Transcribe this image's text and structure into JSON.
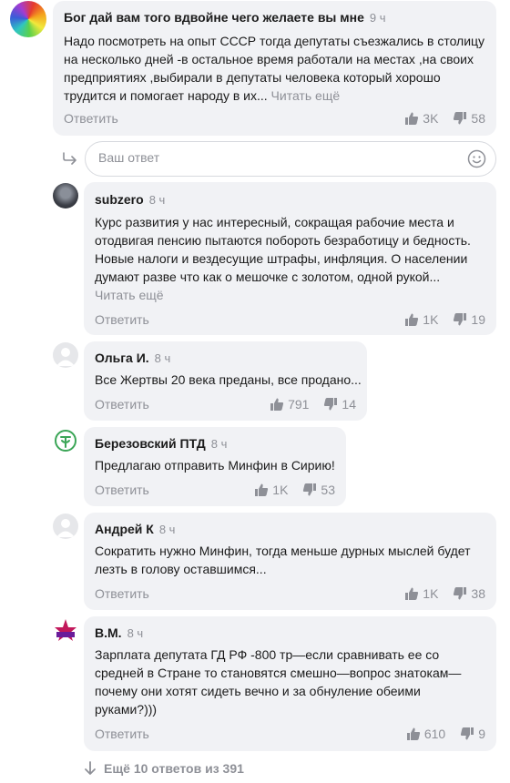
{
  "top_comment": {
    "author": "Бог дай вам того вдвойне чего желаете вы мне",
    "time": "9 ч",
    "text": "Надо посмотреть на опыт СССР тогда депутаты  съезжались в столицу на несколько дней -в остальное время работали на местах ,на своих предприятиях ,выбирали в депутаты человека который хорошо трудится и помогает народу в их...",
    "read_more": "Читать ещё",
    "reply_label": "Ответить",
    "likes": "3K",
    "dislikes": "58"
  },
  "reply_input": {
    "placeholder": "Ваш ответ"
  },
  "replies": [
    {
      "author": "subzero",
      "time": "8 ч",
      "text": "Курс развития у нас интересный, сокращая рабочие места и отодвигая пенсию пытаются побороть безработицу и бедность. Новые налоги и вездесущие штрафы, инфляция. О населении думают разве что как о мешочке с золотом, одной рукой...",
      "read_more": "Читать ещё",
      "reply_label": "Ответить",
      "likes": "1K",
      "dislikes": "19"
    },
    {
      "author": "Ольга И.",
      "time": "8 ч",
      "text": "Все Жертвы 20 века преданы, все продано...",
      "reply_label": "Ответить",
      "likes": "791",
      "dislikes": "14"
    },
    {
      "author": "Березовский ПТД",
      "time": "8 ч",
      "text": "Предлагаю отправить Минфин в Сирию!",
      "reply_label": "Ответить",
      "likes": "1K",
      "dislikes": "53"
    },
    {
      "author": "Андрей К",
      "time": "8 ч",
      "text": "Сократить нужно Минфин, тогда меньше дурных мыслей будет лезть в голову оставшимся...",
      "reply_label": "Ответить",
      "likes": "1K",
      "dislikes": "38"
    },
    {
      "author": "В.М.",
      "time": "8 ч",
      "text": "Зарплата депутата ГД РФ -800 тр—если сравнивать ее со средней в Стране то становятся смешно—вопрос знатокам—почему они хотят сидеть вечно и за обнуление обеими руками?)))",
      "reply_label": "Ответить",
      "likes": "610",
      "dislikes": "9"
    }
  ],
  "more_replies": "Ещё 10 ответов из 391",
  "colors": {
    "bubble": "#f1f2f5",
    "muted_text": "#8e9097",
    "body_text": "#1b1b1b"
  },
  "icons": [
    "thumb-up-icon",
    "thumb-down-icon",
    "emoji-icon",
    "reply-arrow-icon",
    "arrow-down-icon",
    "default-avatar-icon"
  ]
}
